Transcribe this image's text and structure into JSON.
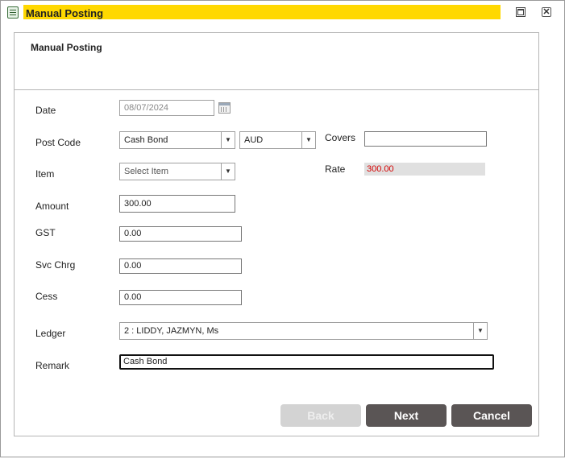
{
  "window": {
    "title": "Manual Posting",
    "close_glyph": "✕",
    "icons": {
      "app": "form-icon",
      "maximize": "maximize-icon",
      "close": "close-icon"
    },
    "title_highlight_color": "#ffd800"
  },
  "panel": {
    "title": "Manual Posting"
  },
  "form": {
    "date": {
      "label": "Date",
      "value": "08/07/2024"
    },
    "post_code": {
      "label": "Post Code",
      "value": "Cash Bond",
      "currency": "AUD"
    },
    "covers": {
      "label": "Covers",
      "value": ""
    },
    "item": {
      "label": "Item",
      "value": "Select Item"
    },
    "rate": {
      "label": "Rate",
      "value": "300.00"
    },
    "amount": {
      "label": "Amount",
      "value": "300.00"
    },
    "gst": {
      "label": "GST",
      "value": "0.00"
    },
    "svc_chrg": {
      "label": "Svc Chrg",
      "value": "0.00"
    },
    "cess": {
      "label": "Cess",
      "value": "0.00"
    },
    "ledger": {
      "label": "Ledger",
      "value": "2 : LIDDY, JAZMYN, Ms"
    },
    "remark": {
      "label": "Remark",
      "value": "Cash Bond"
    }
  },
  "buttons": {
    "back": "Back",
    "next": "Next",
    "cancel": "Cancel"
  },
  "colors": {
    "primary_button": "#5a5555",
    "disabled_button": "#d3d3d3",
    "rate_text": "#d40000"
  },
  "dropdown_glyph": "▼"
}
